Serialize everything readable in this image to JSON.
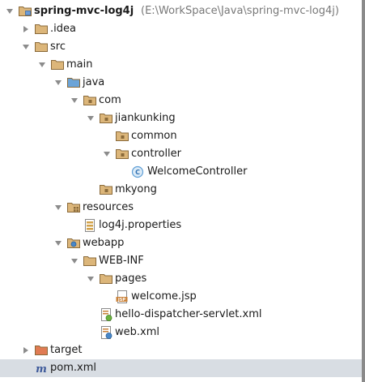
{
  "project": {
    "name": "spring-mvc-log4j",
    "path": "(E:\\WorkSpace\\Java\\spring-mvc-log4j)"
  },
  "tree": [
    {
      "label": "spring-mvc-log4j",
      "depth": 0,
      "icon": "module-folder-icon",
      "expanded": true
    },
    {
      "label": ".idea",
      "depth": 1,
      "icon": "folder-icon",
      "expanded": false
    },
    {
      "label": "src",
      "depth": 1,
      "icon": "folder-icon",
      "expanded": true
    },
    {
      "label": "main",
      "depth": 2,
      "icon": "folder-icon",
      "expanded": true
    },
    {
      "label": "java",
      "depth": 3,
      "icon": "source-root-folder-icon",
      "expanded": true
    },
    {
      "label": "com",
      "depth": 4,
      "icon": "package-icon",
      "expanded": true
    },
    {
      "label": "jiankunking",
      "depth": 5,
      "icon": "package-icon",
      "expanded": true
    },
    {
      "label": "common",
      "depth": 6,
      "icon": "package-icon",
      "expanded": null
    },
    {
      "label": "controller",
      "depth": 6,
      "icon": "package-icon",
      "expanded": true
    },
    {
      "label": "WelcomeController",
      "depth": 7,
      "icon": "java-class-icon",
      "expanded": null
    },
    {
      "label": "mkyong",
      "depth": 5,
      "icon": "package-icon",
      "expanded": null
    },
    {
      "label": "resources",
      "depth": 3,
      "icon": "resources-folder-icon",
      "expanded": true
    },
    {
      "label": "log4j.properties",
      "depth": 4,
      "icon": "properties-file-icon",
      "expanded": null
    },
    {
      "label": "webapp",
      "depth": 3,
      "icon": "web-folder-icon",
      "expanded": true
    },
    {
      "label": "WEB-INF",
      "depth": 4,
      "icon": "folder-icon",
      "expanded": true
    },
    {
      "label": "pages",
      "depth": 5,
      "icon": "folder-icon",
      "expanded": true
    },
    {
      "label": "welcome.jsp",
      "depth": 6,
      "icon": "jsp-file-icon",
      "expanded": null
    },
    {
      "label": "hello-dispatcher-servlet.xml",
      "depth": 5,
      "icon": "spring-xml-file-icon",
      "expanded": null
    },
    {
      "label": "web.xml",
      "depth": 5,
      "icon": "web-xml-file-icon",
      "expanded": null
    },
    {
      "label": "target",
      "depth": 1,
      "icon": "excluded-folder-icon",
      "expanded": false
    },
    {
      "label": "pom.xml",
      "depth": 1,
      "icon": "maven-file-icon",
      "expanded": null,
      "selected": true
    }
  ],
  "colors": {
    "folder": "#dcb67a",
    "source_root": "#6ba4d8",
    "excluded": "#e07b53",
    "class_badge": "#5f9fd6",
    "selection": "#d8dde3"
  }
}
